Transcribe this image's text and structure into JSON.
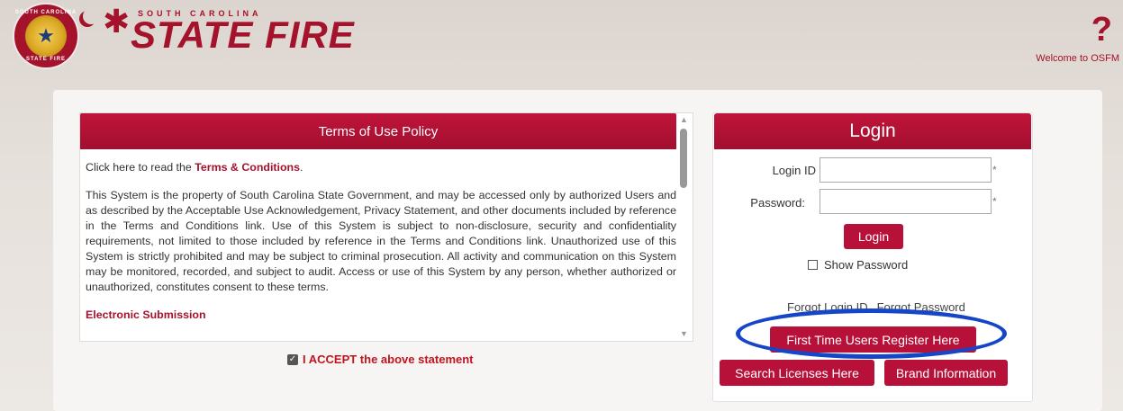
{
  "header": {
    "logo_top": "SOUTH CAROLINA",
    "logo_main": "STATE FIRE",
    "seal_top": "SOUTH CAROLINA",
    "seal_bottom": "STATE FIRE",
    "help_glyph": "?",
    "welcome": "Welcome to OSFM"
  },
  "terms": {
    "title": "Terms of Use Policy",
    "intro_prefix": "Click here to read the ",
    "intro_link": "Terms & Conditions",
    "intro_suffix": ".",
    "body": "This System is the property of South Carolina State Government, and may be accessed only by authorized Users and as described by the Acceptable Use Acknowledgement, Privacy Statement, and other documents included by reference in the Terms and Conditions link. Use of this System is subject to non-disclosure, security and confidentiality requirements, not limited to those included by reference in the Terms and Conditions link. Unauthorized use of this System is strictly prohibited and may be subject to criminal prosecution. All activity and communication on this System may be monitored, recorded, and subject to audit. Access or use of this System by any person, whether authorized or unauthorized, constitutes consent to these terms.",
    "next_heading": "Electronic Submission",
    "accept_label": "I ACCEPT the above statement"
  },
  "login": {
    "title": "Login",
    "login_id_label": "Login ID",
    "login_id_value": "",
    "password_label": "Password:",
    "password_value": "",
    "required_mark": "*",
    "login_button": "Login",
    "show_password": "Show Password",
    "forgot_login_id": "Forgot Login ID",
    "forgot_password": "Forgot Password",
    "register_button": "First Time Users Register Here",
    "search_button": "Search Licenses Here",
    "brand_button": "Brand Information"
  },
  "colors": {
    "brand": "#a4122b",
    "button": "#b7113a",
    "annotation": "#1546c8"
  }
}
